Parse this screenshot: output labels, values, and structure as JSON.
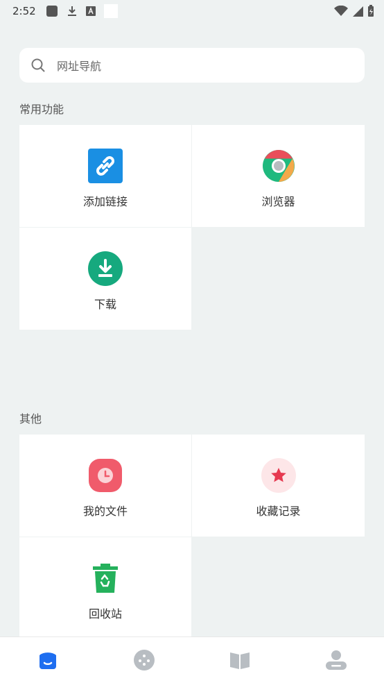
{
  "status_bar": {
    "time": "2:52"
  },
  "search": {
    "placeholder": "网址导航"
  },
  "sections": {
    "common": {
      "title": "常用功能",
      "items": [
        {
          "label": "添加链接",
          "icon": "link-icon",
          "color": "#1a8fe3"
        },
        {
          "label": "浏览器",
          "icon": "chrome-browser-icon"
        },
        {
          "label": "下载",
          "icon": "download-icon",
          "color": "#16a97e"
        }
      ]
    },
    "other": {
      "title": "其他",
      "items": [
        {
          "label": "我的文件",
          "icon": "clock-file-icon",
          "color": "#f05b6b"
        },
        {
          "label": "收藏记录",
          "icon": "star-icon",
          "color": "#e63950"
        },
        {
          "label": "回收站",
          "icon": "recycle-bin-icon",
          "color": "#25b15c"
        }
      ]
    }
  },
  "bottom_nav": {
    "tabs": [
      {
        "icon": "home-icon",
        "active": true
      },
      {
        "icon": "discover-icon",
        "active": false
      },
      {
        "icon": "book-icon",
        "active": false
      },
      {
        "icon": "profile-icon",
        "active": false
      }
    ],
    "active_color": "#1e6ef0",
    "inactive_color": "#b8bdc2"
  }
}
